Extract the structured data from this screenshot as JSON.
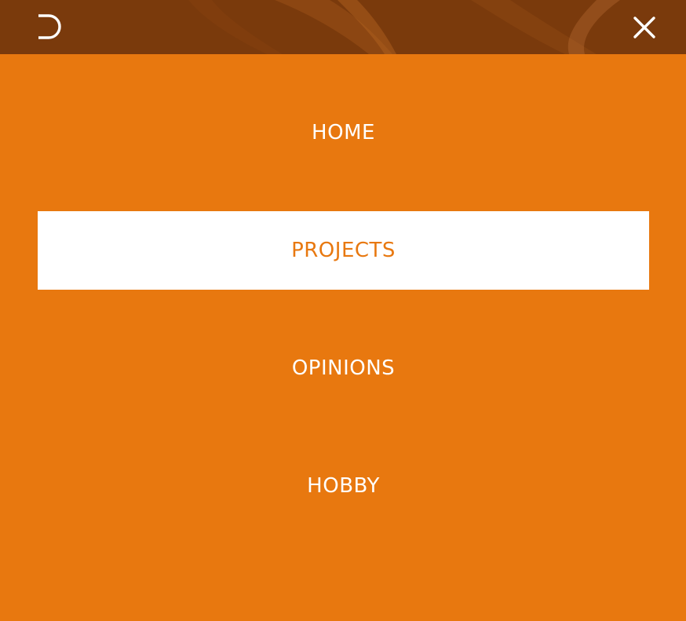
{
  "header": {
    "logo_icon": "logo-d-icon",
    "close_icon": "close-icon",
    "colors": {
      "bar": "#7a3a0c",
      "logo": "#ffffff",
      "close": "#ffffff"
    }
  },
  "menu": {
    "items": [
      {
        "label": "HOME",
        "active": false
      },
      {
        "label": "PROJECTS",
        "active": true
      },
      {
        "label": "OPINIONS",
        "active": false
      },
      {
        "label": "HOBBY",
        "active": false
      }
    ]
  },
  "colors": {
    "background": "#e8780f",
    "active_bg": "#ffffff",
    "active_text": "#e8780f",
    "text": "#ffffff"
  }
}
